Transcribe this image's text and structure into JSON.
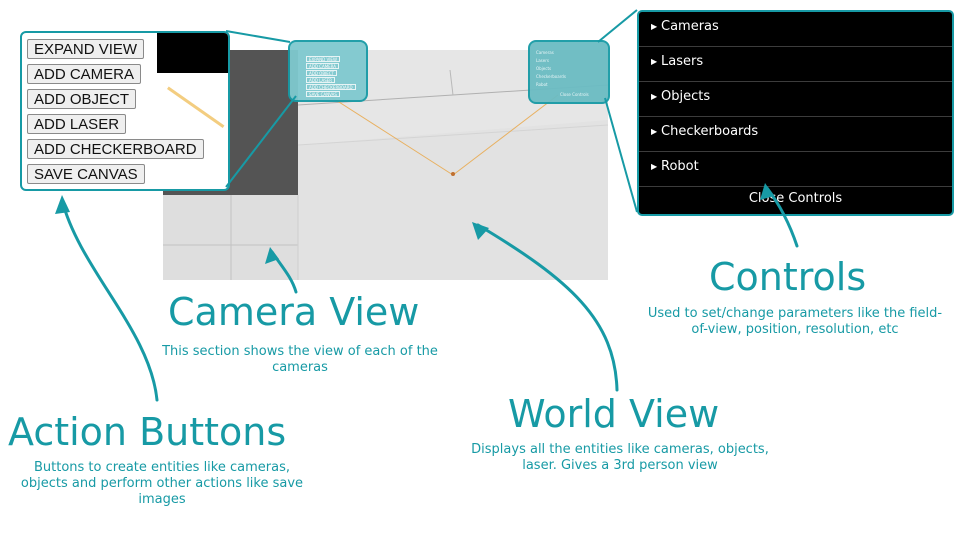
{
  "action_buttons": [
    {
      "label": "EXPAND VIEW"
    },
    {
      "label": "ADD CAMERA"
    },
    {
      "label": "ADD OBJECT"
    },
    {
      "label": "ADD LASER"
    },
    {
      "label": "ADD CHECKERBOARD"
    },
    {
      "label": "SAVE CANVAS"
    }
  ],
  "controls": {
    "items": [
      {
        "label": "Cameras"
      },
      {
        "label": "Lasers"
      },
      {
        "label": "Objects"
      },
      {
        "label": "Checkerboards"
      },
      {
        "label": "Robot"
      }
    ],
    "close_label": "Close Controls"
  },
  "annotations": {
    "camera_view": {
      "title": "Camera View",
      "desc": "This section shows the view of each of the cameras"
    },
    "action_buttons": {
      "title": "Action Buttons",
      "desc": "Buttons to create entities like cameras, objects and perform other actions like save images"
    },
    "world_view": {
      "title": "World View",
      "desc": "Displays all the entities like cameras, objects, laser. Gives a 3rd person view"
    },
    "controls": {
      "title": "Controls",
      "desc": "Used to set/change parameters like the field-of-view, position, resolution, etc"
    }
  },
  "colors": {
    "accent": "#179aa5",
    "panel_bg": "#000000",
    "camera_view_bg": "#545454",
    "world_bg": "#e6e6e6"
  }
}
